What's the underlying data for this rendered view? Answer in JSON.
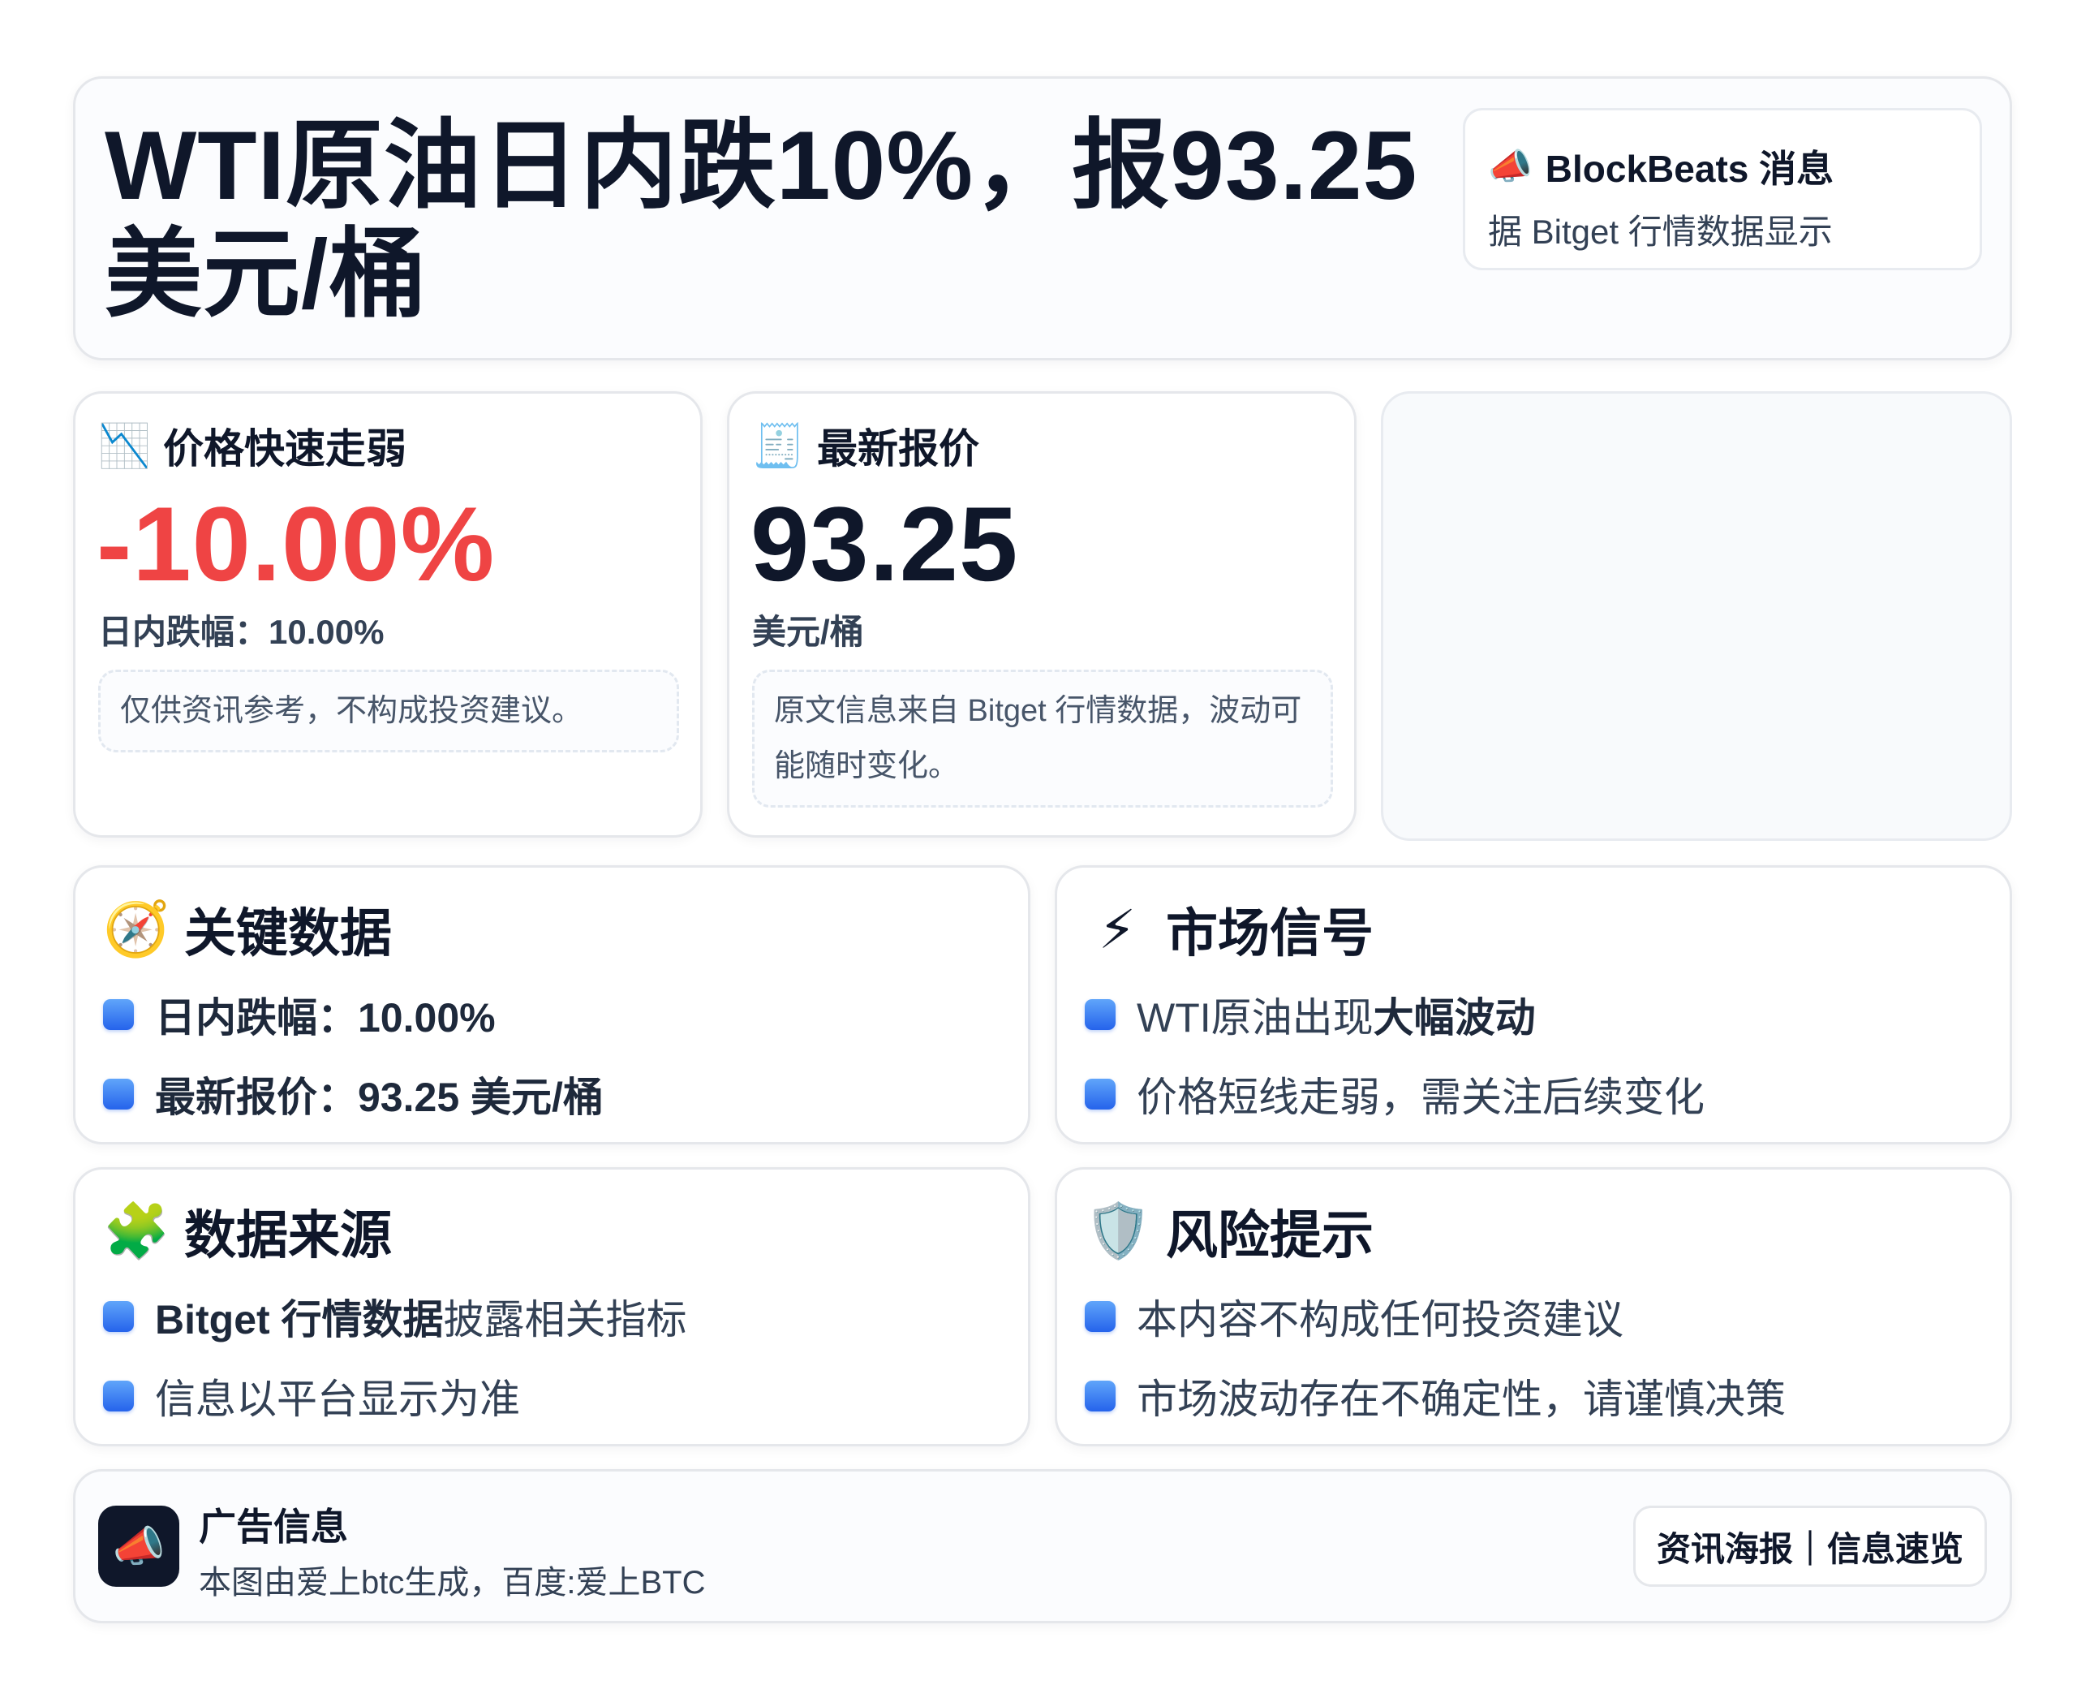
{
  "header": {
    "title": "WTI原油日内跌10%，报93.25美元/桶",
    "source_name": "BlockBeats 消息",
    "source_icon": "megaphone-icon",
    "source_desc": "据 Bitget 行情数据显示"
  },
  "stats": {
    "drop": {
      "icon": "chart-down-icon",
      "label": "价格快速走弱",
      "value": "-10.00%",
      "sub": "日内跌幅：10.00%",
      "note": "仅供资讯参考，不构成投资建议。",
      "color": "#ef4444"
    },
    "price": {
      "icon": "receipt-icon",
      "label": "最新报价",
      "value": "93.25",
      "sub": "美元/桶",
      "note": "原文信息来自 Bitget 行情数据，波动可能随时变化。"
    }
  },
  "cards": {
    "key": {
      "icon": "compass-icon",
      "title": "关键数据",
      "items": [
        "日内跌幅：10.00%",
        "最新报价：93.25 美元/桶"
      ]
    },
    "signal": {
      "icon": "lightning-icon",
      "title": "市场信号",
      "items": [
        {
          "prefix": "WTI原油出现 ",
          "bold": "大幅波动"
        },
        {
          "text": "价格短线走弱，需关注后续变化"
        }
      ]
    },
    "source": {
      "icon": "puzzle-icon",
      "title": "数据来源",
      "items": [
        {
          "bold": "Bitget 行情数据",
          "suffix": "披露相关指标"
        },
        {
          "text": "信息以平台显示为准"
        }
      ]
    },
    "risk": {
      "icon": "shield-icon",
      "title": "风险提示",
      "items": [
        "本内容不构成任何投资建议",
        "市场波动存在不确定性，请谨慎决策"
      ]
    }
  },
  "footer": {
    "icon": "megaphone-icon",
    "title": "广告信息",
    "desc": "本图由爱上btc生成，百度:爱上BTC",
    "tag": "资讯海报｜信息速览"
  },
  "colors": {
    "accent_blue": "#3b82f6",
    "negative_red": "#ef4444",
    "text_dark": "#0f172a"
  }
}
